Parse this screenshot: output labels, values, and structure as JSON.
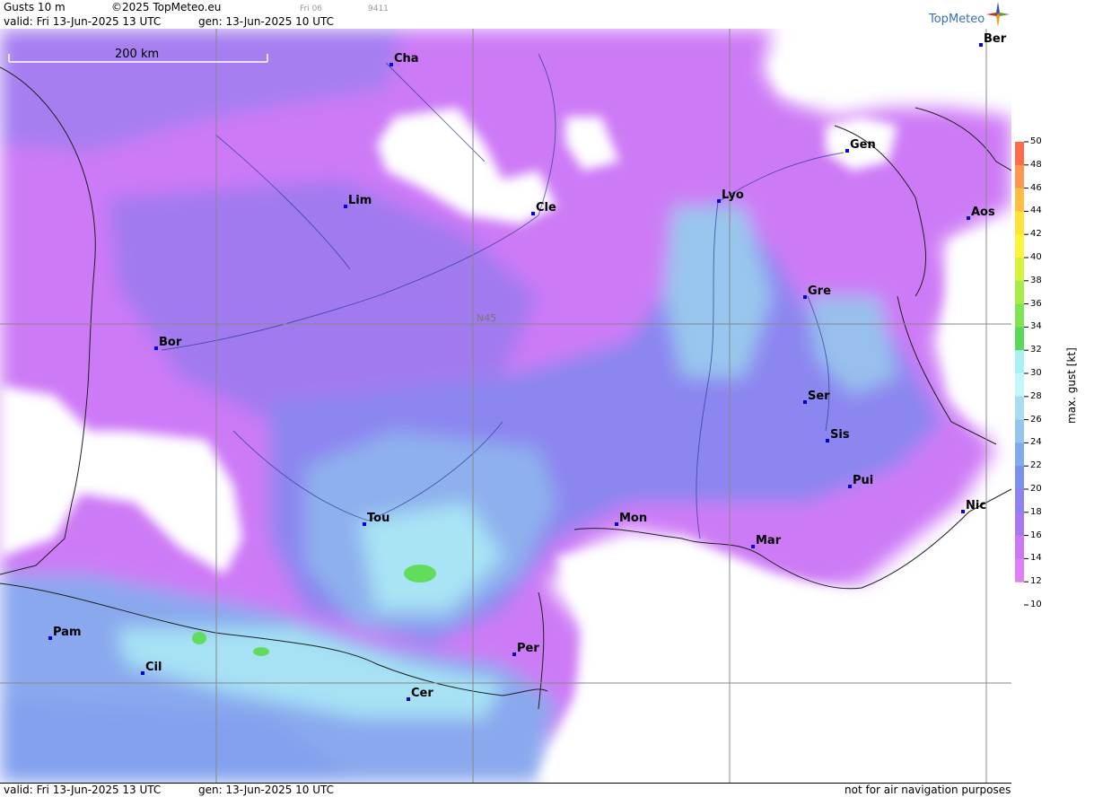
{
  "header": {
    "product": "Gusts 10 m",
    "copyright": "©2025 TopMeteo.eu",
    "run_label": "Fri 06",
    "code": "9411",
    "valid": "valid:  Fri  13-Jun-2025  13 UTC",
    "gen": "gen: 13-Jun-2025 10 UTC",
    "logo_text": "TopMeteo"
  },
  "scale_bar": {
    "label": "200 km"
  },
  "grid": {
    "lat_label": "N45"
  },
  "cities": [
    {
      "name": "Cha"
    },
    {
      "name": "Ber"
    },
    {
      "name": "Gen"
    },
    {
      "name": "Lim"
    },
    {
      "name": "Cle"
    },
    {
      "name": "Lyo"
    },
    {
      "name": "Aos"
    },
    {
      "name": "Gre"
    },
    {
      "name": "Bor"
    },
    {
      "name": "Ser"
    },
    {
      "name": "Sis"
    },
    {
      "name": "Pui"
    },
    {
      "name": "Nic"
    },
    {
      "name": "Tou"
    },
    {
      "name": "Mon"
    },
    {
      "name": "Mar"
    },
    {
      "name": "Pam"
    },
    {
      "name": "Cil"
    },
    {
      "name": "Per"
    },
    {
      "name": "Cer"
    }
  ],
  "legend": {
    "title": "max. gust [kt]",
    "ticks": [
      "50",
      "48",
      "46",
      "44",
      "42",
      "40",
      "38",
      "36",
      "34",
      "32",
      "30",
      "28",
      "26",
      "24",
      "22",
      "20",
      "18",
      "16",
      "14",
      "12",
      "10"
    ],
    "colors": {
      "48": "#ff6a4d",
      "46": "#ff9650",
      "44": "#ffbe40",
      "42": "#ffe23a",
      "40": "#fff33c",
      "38": "#d4f43c",
      "36": "#a8ec48",
      "34": "#7fe452",
      "32": "#5ad85a",
      "30": "#a8f0f4",
      "28": "#c4f5f8",
      "26": "#a8dcf0",
      "24": "#94c6ec",
      "22": "#82aaee",
      "20": "#7a90ee",
      "18": "#8e82f0",
      "16": "#a778f2",
      "14": "#cc78f6",
      "12": "#e47ef8"
    }
  },
  "footer": {
    "valid": "valid:  Fri  13-Jun-2025  13 UTC",
    "gen": "gen: 13-Jun-2025 10 UTC",
    "disclaimer": "not for air navigation purposes"
  }
}
